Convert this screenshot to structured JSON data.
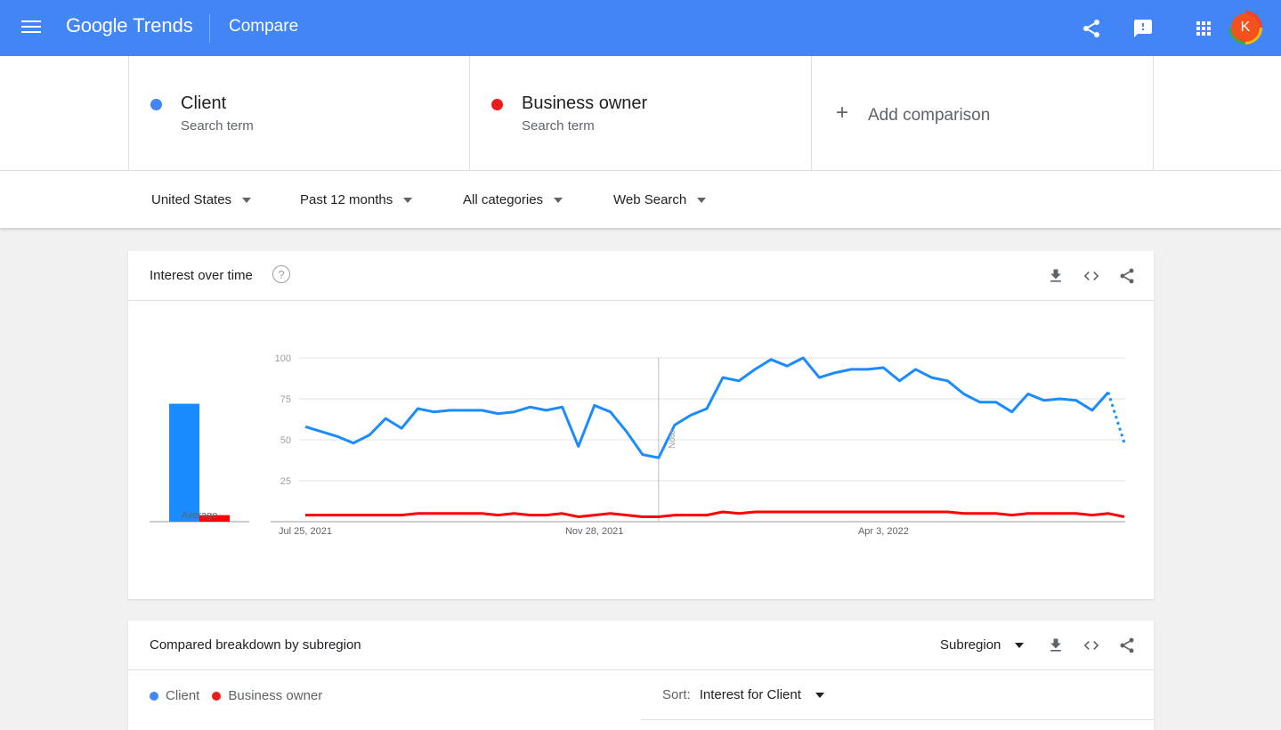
{
  "header": {
    "logo_google": "Google",
    "logo_trends": "Trends",
    "title": "Compare",
    "icons": [
      "menu-icon",
      "share-icon",
      "feedback-icon",
      "apps-icon"
    ],
    "avatar_letter": "K"
  },
  "terms": [
    {
      "name": "Client",
      "type": "Search term",
      "color": "#4285f4"
    },
    {
      "name": "Business owner",
      "type": "Search term",
      "color": "#ea1d1d"
    }
  ],
  "add_comparison": "Add comparison",
  "filters": {
    "region": "United States",
    "time": "Past 12 months",
    "category": "All categories",
    "property": "Web Search"
  },
  "interest_card": {
    "title": "Interest over time",
    "help": "?",
    "icons": [
      "download-icon",
      "embed-icon",
      "share-icon"
    ]
  },
  "chart_data": {
    "type": "line",
    "title": "Interest over time",
    "y_ticks": [
      25,
      50,
      75,
      100
    ],
    "ylim": [
      0,
      100
    ],
    "x_tick_labels": [
      "Jul 25, 2021",
      "Nov 28, 2021",
      "Apr 3, 2022"
    ],
    "annotation": "Note",
    "average_label": "Average",
    "averages": [
      {
        "name": "Client",
        "value": 72,
        "color": "#1a8cff"
      },
      {
        "name": "Business owner",
        "value": 4,
        "color": "#ff0000"
      }
    ],
    "series": [
      {
        "name": "Client",
        "color": "#1a8cff",
        "values": [
          58,
          55,
          52,
          48,
          53,
          63,
          57,
          69,
          67,
          68,
          68,
          68,
          66,
          67,
          70,
          68,
          70,
          46,
          71,
          67,
          55,
          41,
          39,
          59,
          65,
          69,
          88,
          86,
          93,
          99,
          95,
          100,
          88,
          91,
          93,
          93,
          94,
          86,
          93,
          88,
          86,
          78,
          73,
          73,
          67,
          78,
          74,
          75,
          74,
          68,
          79,
          48
        ],
        "partial_last": true
      },
      {
        "name": "Business owner",
        "color": "#ff0000",
        "values": [
          4,
          4,
          4,
          4,
          4,
          4,
          4,
          5,
          5,
          5,
          5,
          5,
          4,
          5,
          4,
          4,
          5,
          3,
          4,
          5,
          4,
          3,
          3,
          4,
          4,
          4,
          6,
          5,
          6,
          6,
          6,
          6,
          6,
          6,
          6,
          6,
          6,
          6,
          6,
          6,
          6,
          5,
          5,
          5,
          4,
          5,
          5,
          5,
          5,
          4,
          5,
          3
        ]
      }
    ]
  },
  "subregion_card": {
    "title": "Compared breakdown by subregion",
    "dropdown": "Subregion",
    "legend": [
      "Client",
      "Business owner"
    ],
    "sort_label": "Sort:",
    "sort_value": "Interest for Client"
  }
}
